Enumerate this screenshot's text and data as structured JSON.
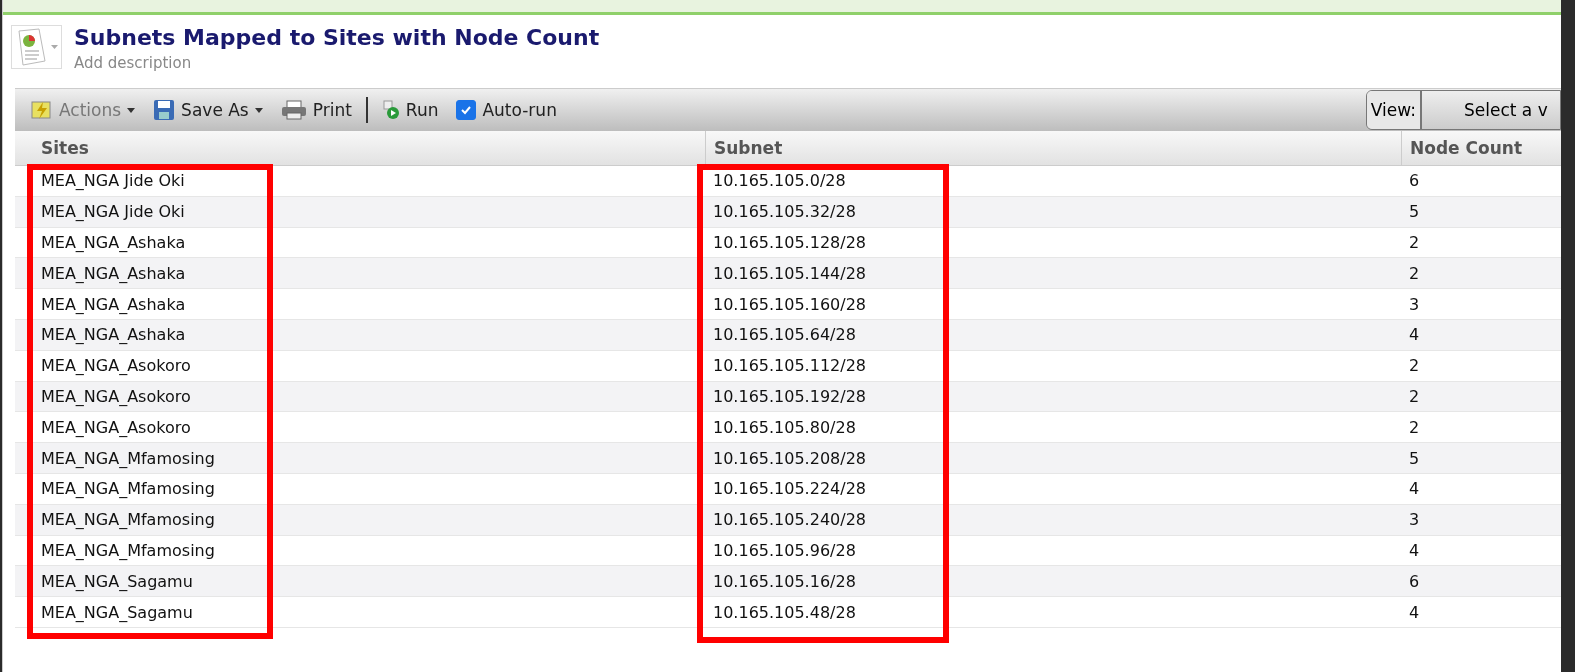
{
  "report": {
    "title": "Subnets Mapped to Sites with Node Count",
    "description": "Add description"
  },
  "toolbar": {
    "actions": "Actions",
    "save_as": "Save As",
    "print": "Print",
    "run": "Run",
    "auto_run": {
      "label": "Auto-run",
      "checked": true
    },
    "view_label": "View:",
    "view_select": "Select a v"
  },
  "table": {
    "columns": [
      "Sites",
      "Subnet",
      "Node Count"
    ],
    "rows": [
      [
        "MEA_NGA Jide Oki",
        "10.165.105.0/28",
        "6"
      ],
      [
        "MEA_NGA Jide Oki",
        "10.165.105.32/28",
        "5"
      ],
      [
        "MEA_NGA_Ashaka",
        "10.165.105.128/28",
        "2"
      ],
      [
        "MEA_NGA_Ashaka",
        "10.165.105.144/28",
        "2"
      ],
      [
        "MEA_NGA_Ashaka",
        "10.165.105.160/28",
        "3"
      ],
      [
        "MEA_NGA_Ashaka",
        "10.165.105.64/28",
        "4"
      ],
      [
        "MEA_NGA_Asokoro",
        "10.165.105.112/28",
        "2"
      ],
      [
        "MEA_NGA_Asokoro",
        "10.165.105.192/28",
        "2"
      ],
      [
        "MEA_NGA_Asokoro",
        "10.165.105.80/28",
        "2"
      ],
      [
        "MEA_NGA_Mfamosing",
        "10.165.105.208/28",
        "5"
      ],
      [
        "MEA_NGA_Mfamosing",
        "10.165.105.224/28",
        "4"
      ],
      [
        "MEA_NGA_Mfamosing",
        "10.165.105.240/28",
        "3"
      ],
      [
        "MEA_NGA_Mfamosing",
        "10.165.105.96/28",
        "4"
      ],
      [
        "MEA_NGA_Sagamu",
        "10.165.105.16/28",
        "6"
      ],
      [
        "MEA_NGA_Sagamu",
        "10.165.105.48/28",
        "4"
      ]
    ]
  }
}
